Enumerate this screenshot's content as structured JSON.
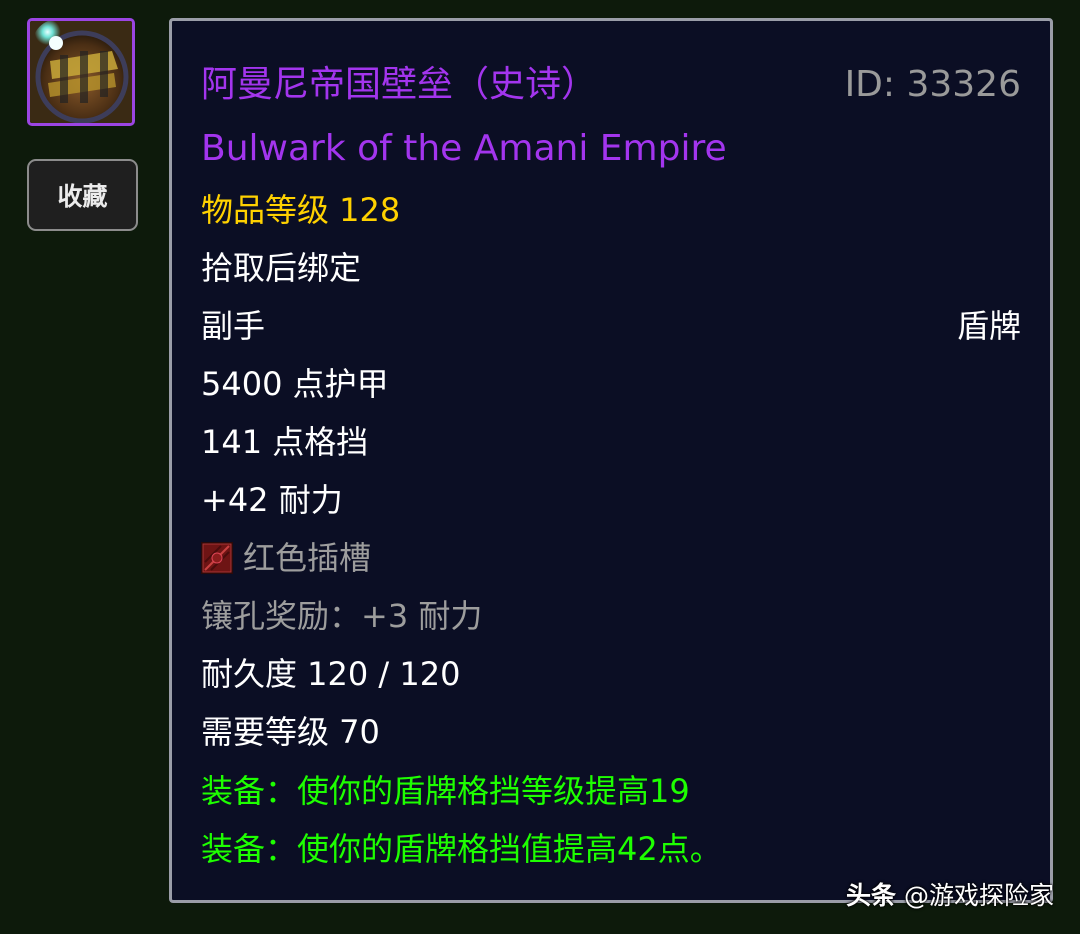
{
  "item": {
    "name_cn": "阿曼尼帝国壁垒（史诗）",
    "id_text": "ID: 33326",
    "name_en": "Bulwark of the Amani Empire",
    "item_level": "物品等级 128",
    "bind": "拾取后绑定",
    "slot": "副手",
    "type": "盾牌",
    "armor": "5400 点护甲",
    "block": "141 点格挡",
    "stamina": "+42 耐力",
    "socket": "红色插槽",
    "socket_bonus": "镶孔奖励：+3 耐力",
    "durability": "耐久度 120 / 120",
    "required_level": "需要等级 70",
    "equip_1": "装备：使你的盾牌格挡等级提高19",
    "equip_2": "装备：使你的盾牌格挡值提高42点。"
  },
  "sidebar": {
    "favorite_label": "收藏",
    "icon": "shield-item-icon"
  },
  "watermark": {
    "brand": "头条",
    "author": "@游戏探险家"
  },
  "colors": {
    "epic": "#a335ee",
    "item_level": "#ffd100",
    "equip": "#1eff00",
    "muted": "#9d9d9d",
    "tooltip_bg": "#0b0e24",
    "page_bg": "#0d1a0b"
  }
}
